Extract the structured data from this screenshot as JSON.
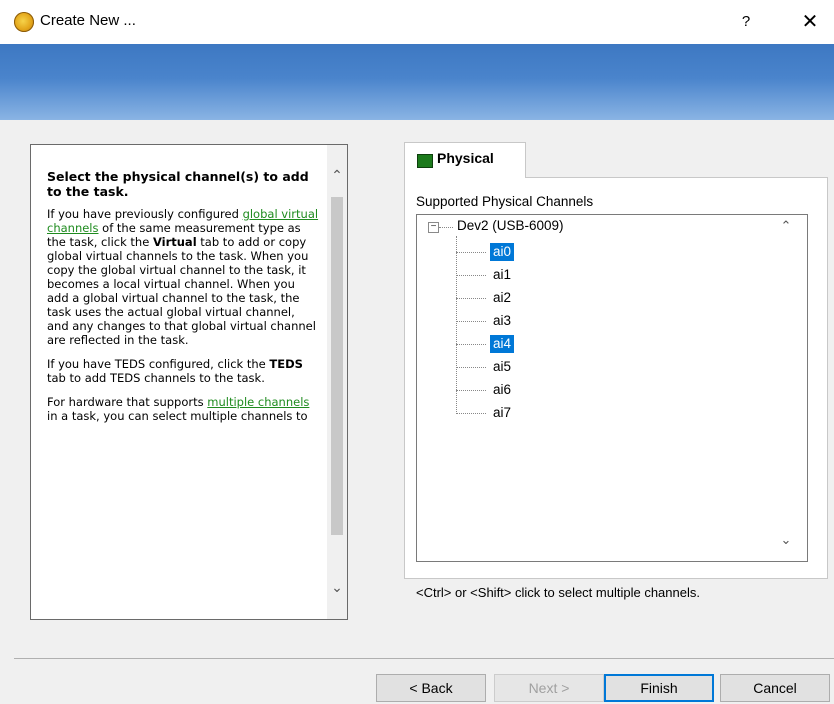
{
  "window": {
    "title": "Create New ...",
    "help_label": "?",
    "close_label": "✕",
    "icon": "ni-daqmx-gear-icon",
    "banner_color": "#4a84cc"
  },
  "help": {
    "heading": "Select the physical channel(s) to add to the task.",
    "p1_a": "If you have previously configured ",
    "p1_link": "global virtual channels",
    "p1_b": " of the same measurement type as the task, click the ",
    "p1_bold": "Virtual",
    "p1_c": " tab to add or copy global virtual channels to the task. When you copy the global virtual channel to the task, it becomes a local virtual channel. When you add a global virtual channel to the task, the task uses the actual global virtual channel, and any changes to that global virtual channel are reflected in the task.",
    "p2_a": "If you have TEDS configured, click the ",
    "p2_bold": "TEDS",
    "p2_b": " tab to add TEDS channels to the task.",
    "p3_a": "For hardware that supports ",
    "p3_link": "multiple channels",
    "p3_b": " in a task, you can select multiple channels to",
    "scroll_up": "⌃",
    "scroll_down": "⌄"
  },
  "tabs": {
    "physical_label": "Physical"
  },
  "channels": {
    "label": "Supported Physical Channels",
    "expander": "−",
    "device": "Dev2  (USB-6009)",
    "items": [
      {
        "label": "ai0",
        "selected": true
      },
      {
        "label": "ai1",
        "selected": false
      },
      {
        "label": "ai2",
        "selected": false
      },
      {
        "label": "ai3",
        "selected": false
      },
      {
        "label": "ai4",
        "selected": true
      },
      {
        "label": "ai5",
        "selected": false
      },
      {
        "label": "ai6",
        "selected": false
      },
      {
        "label": "ai7",
        "selected": false
      }
    ],
    "hint": "<Ctrl> or <Shift> click to select multiple channels."
  },
  "buttons": {
    "back": "< Back",
    "next": "Next >",
    "finish": "Finish",
    "cancel": "Cancel"
  }
}
